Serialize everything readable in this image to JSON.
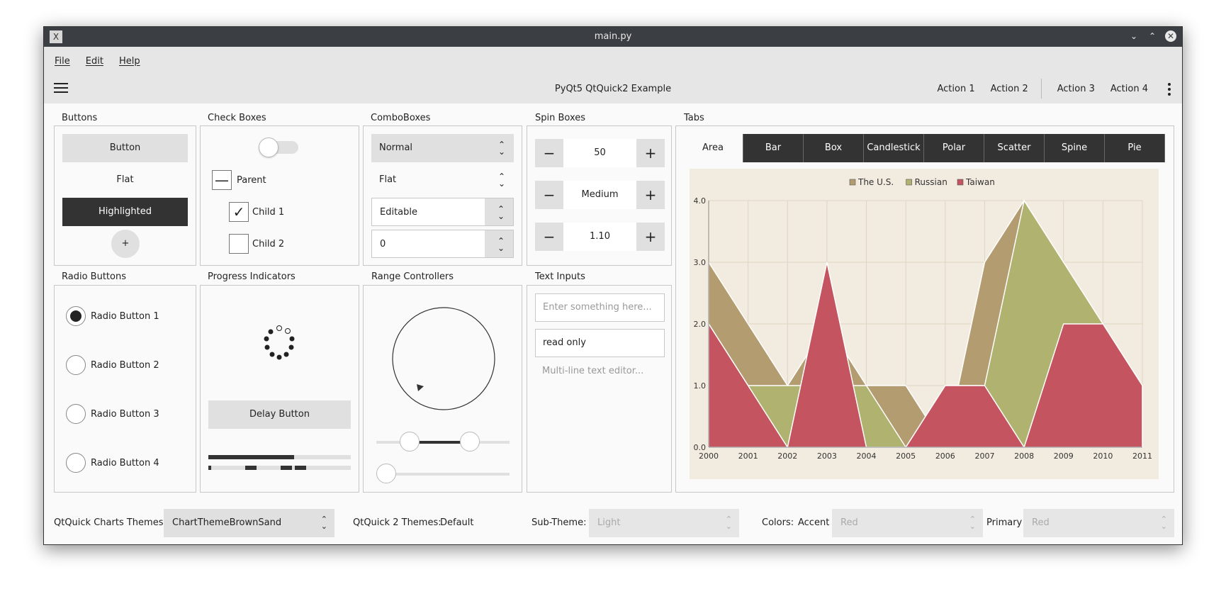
{
  "window": {
    "title": "main.py",
    "icon": "x-app-icon"
  },
  "menu": {
    "items": [
      "File",
      "Edit",
      "Help"
    ]
  },
  "toolbar": {
    "title": "PyQt5 QtQuick2 Example",
    "actions": [
      "Action 1",
      "Action 2",
      "Action 3",
      "Action 4"
    ]
  },
  "buttons": {
    "section": "Buttons",
    "button": "Button",
    "flat": "Flat",
    "highlighted": "Highlighted",
    "round": "+"
  },
  "checkboxes": {
    "section": "Check Boxes",
    "parent": "Parent",
    "child1": "Child 1",
    "child2": "Child 2"
  },
  "comboboxes": {
    "section": "ComboBoxes",
    "normal": "Normal",
    "flat": "Flat",
    "editable": "Editable",
    "number": "0"
  },
  "spinboxes": {
    "section": "Spin Boxes",
    "values": [
      "50",
      "Medium",
      "1.10"
    ]
  },
  "tabs": {
    "section": "Tabs",
    "items": [
      "Area",
      "Bar",
      "Box",
      "Candlestick",
      "Polar",
      "Scatter",
      "Spine",
      "Pie"
    ],
    "active": "Area"
  },
  "radios": {
    "section": "Radio Buttons",
    "items": [
      "Radio Button 1",
      "Radio Button 2",
      "Radio Button 3",
      "Radio Button 4"
    ]
  },
  "progress": {
    "section": "Progress Indicators",
    "delay_button": "Delay Button",
    "bar_value": 0.6
  },
  "range": {
    "section": "Range Controllers",
    "range_slider": [
      0.25,
      0.7
    ],
    "slider": 0.0
  },
  "textinputs": {
    "section": "Text Inputs",
    "placeholder": "Enter something here...",
    "readonly": "read only",
    "multiline_placeholder": "Multi-line text editor..."
  },
  "bottom": {
    "charts_label": "QtQuick Charts Themes:",
    "charts_value": "ChartThemeBrownSand",
    "qq2_label": "QtQuick 2 Themes:",
    "qq2_value": "Default",
    "subtheme_label": "Sub-Theme:",
    "subtheme_value": "Light",
    "colors_label": "Colors:",
    "accent_label": "Accent",
    "accent_value": "Red",
    "primary_label": "Primary",
    "primary_value": "Red"
  },
  "chart_data": {
    "type": "area",
    "x": [
      2000,
      2001,
      2002,
      2003,
      2004,
      2005,
      2006,
      2007,
      2008,
      2009,
      2010,
      2011
    ],
    "xlim": [
      2000,
      2011
    ],
    "ylim": [
      0,
      4
    ],
    "yticks": [
      "0.0",
      "1.0",
      "2.0",
      "3.0",
      "4.0"
    ],
    "legend_position": "top",
    "series": [
      {
        "name": "The U.S.",
        "color": "#b39c70",
        "values": [
          3,
          2,
          1,
          2,
          1,
          1,
          0,
          3,
          4,
          3,
          2,
          1
        ]
      },
      {
        "name": "Russian",
        "color": "#b0b36f",
        "values": [
          2,
          1,
          1,
          1,
          1,
          0,
          1,
          1,
          4,
          3,
          2,
          1
        ]
      },
      {
        "name": "Taiwan",
        "color": "#c4545f",
        "values": [
          2,
          1,
          0,
          3,
          0,
          0,
          1,
          1,
          0,
          2,
          2,
          1
        ]
      }
    ]
  }
}
